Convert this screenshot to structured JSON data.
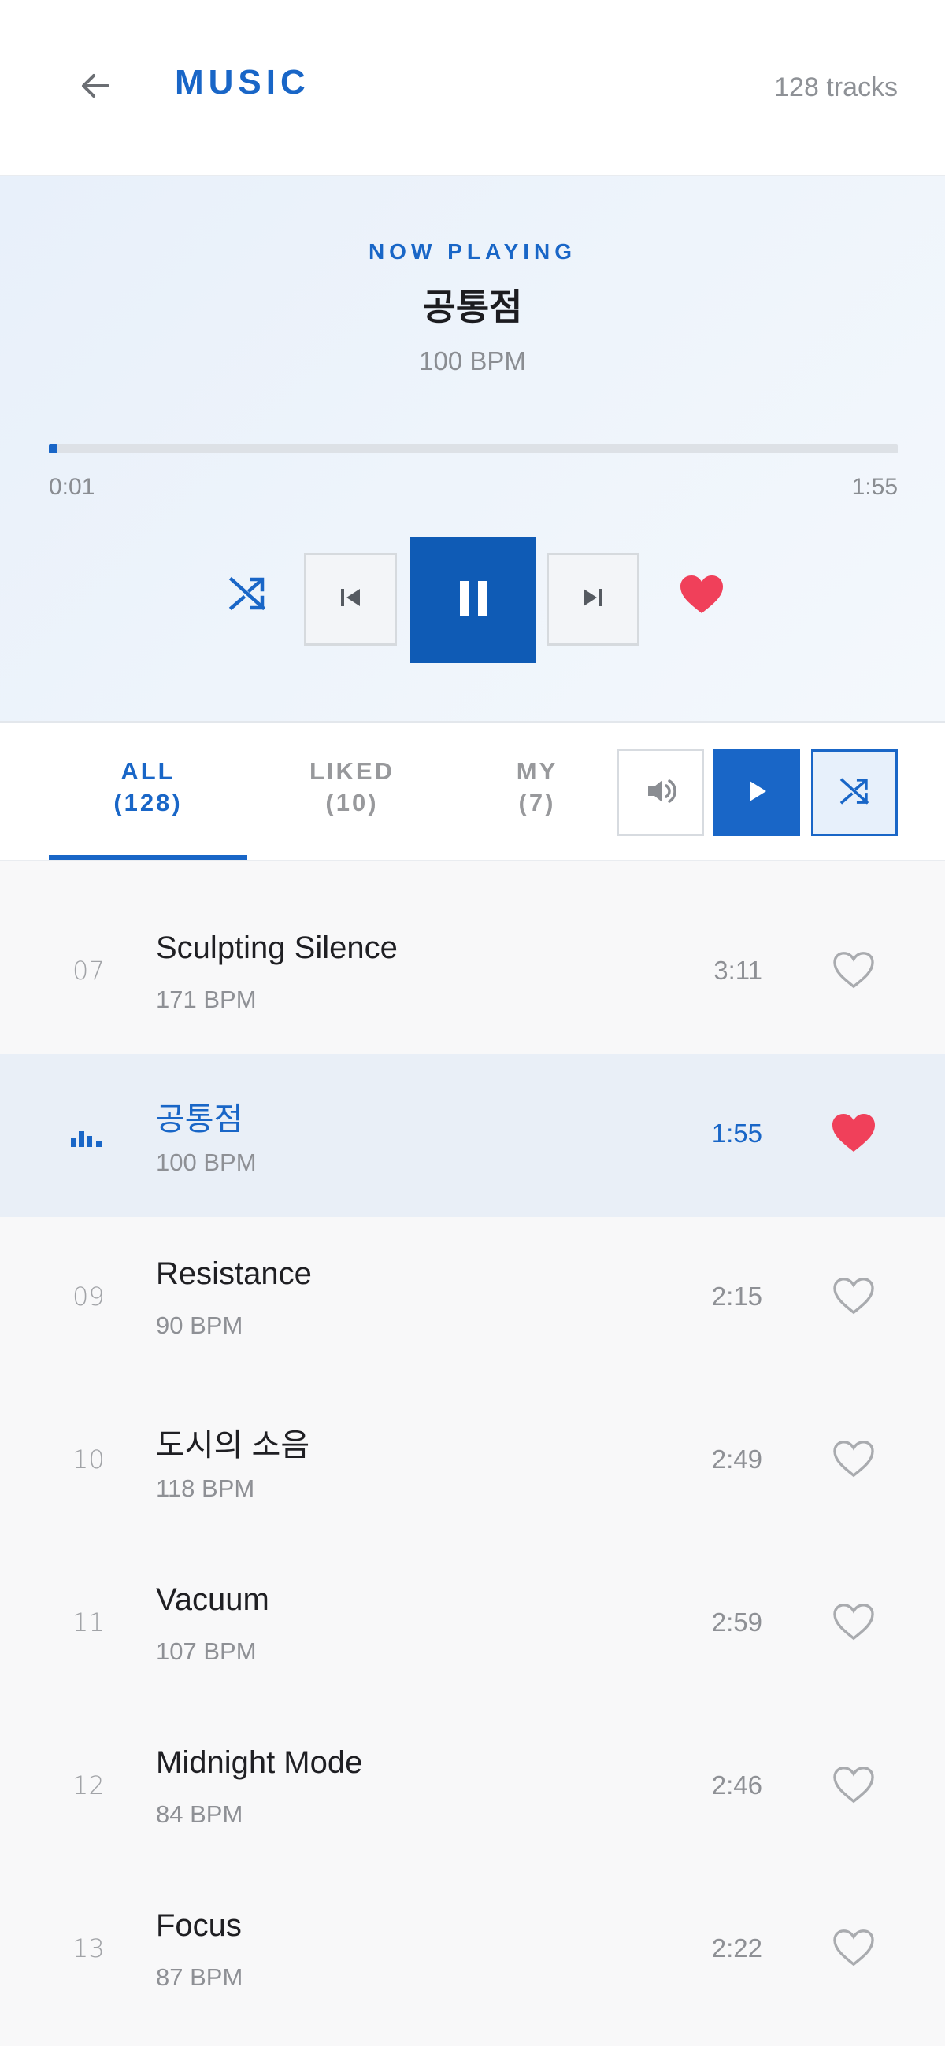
{
  "header": {
    "back_icon": "arrow-left-icon",
    "title": "MUSIC",
    "track_count": "128 tracks"
  },
  "now_playing": {
    "label": "NOW PLAYING",
    "title": "공통점",
    "bpm": "100 BPM",
    "progress": 0.01,
    "time_current": "0:01",
    "time_total": "1:55",
    "liked": true,
    "controls": [
      "shuffle-icon",
      "skip-previous-icon",
      "pause-icon",
      "skip-next-icon",
      "heart-filled-icon"
    ]
  },
  "tabs": [
    {
      "label": "ALL",
      "count": "(128)",
      "active": true
    },
    {
      "label": "LIKED",
      "count": "(10)",
      "active": false
    },
    {
      "label": "MY",
      "count": "(7)",
      "active": false
    }
  ],
  "toolbar": {
    "icons": [
      "volume-icon",
      "play-icon",
      "shuffle-icon"
    ]
  },
  "tracks": [
    {
      "num": "07",
      "title": "Sculpting Silence",
      "bpm": "171 BPM",
      "duration": "3:11",
      "liked": false,
      "current": false
    },
    {
      "num": "",
      "title": "공통점",
      "bpm": "100 BPM",
      "duration": "1:55",
      "liked": true,
      "current": true
    },
    {
      "num": "09",
      "title": "Resistance",
      "bpm": "90 BPM",
      "duration": "2:15",
      "liked": false,
      "current": false
    },
    {
      "num": "10",
      "title": "도시의 소음",
      "bpm": "118 BPM",
      "duration": "2:49",
      "liked": false,
      "current": false
    },
    {
      "num": "11",
      "title": "Vacuum",
      "bpm": "107 BPM",
      "duration": "2:59",
      "liked": false,
      "current": false
    },
    {
      "num": "12",
      "title": "Midnight Mode",
      "bpm": "84 BPM",
      "duration": "2:46",
      "liked": false,
      "current": false
    },
    {
      "num": "13",
      "title": "Focus",
      "bpm": "87 BPM",
      "duration": "2:22",
      "liked": false,
      "current": false
    }
  ],
  "colors": {
    "accent": "#1966c7",
    "accent_dark": "#0f5bb5",
    "heart": "#f0405a",
    "muted": "#8e9095"
  }
}
